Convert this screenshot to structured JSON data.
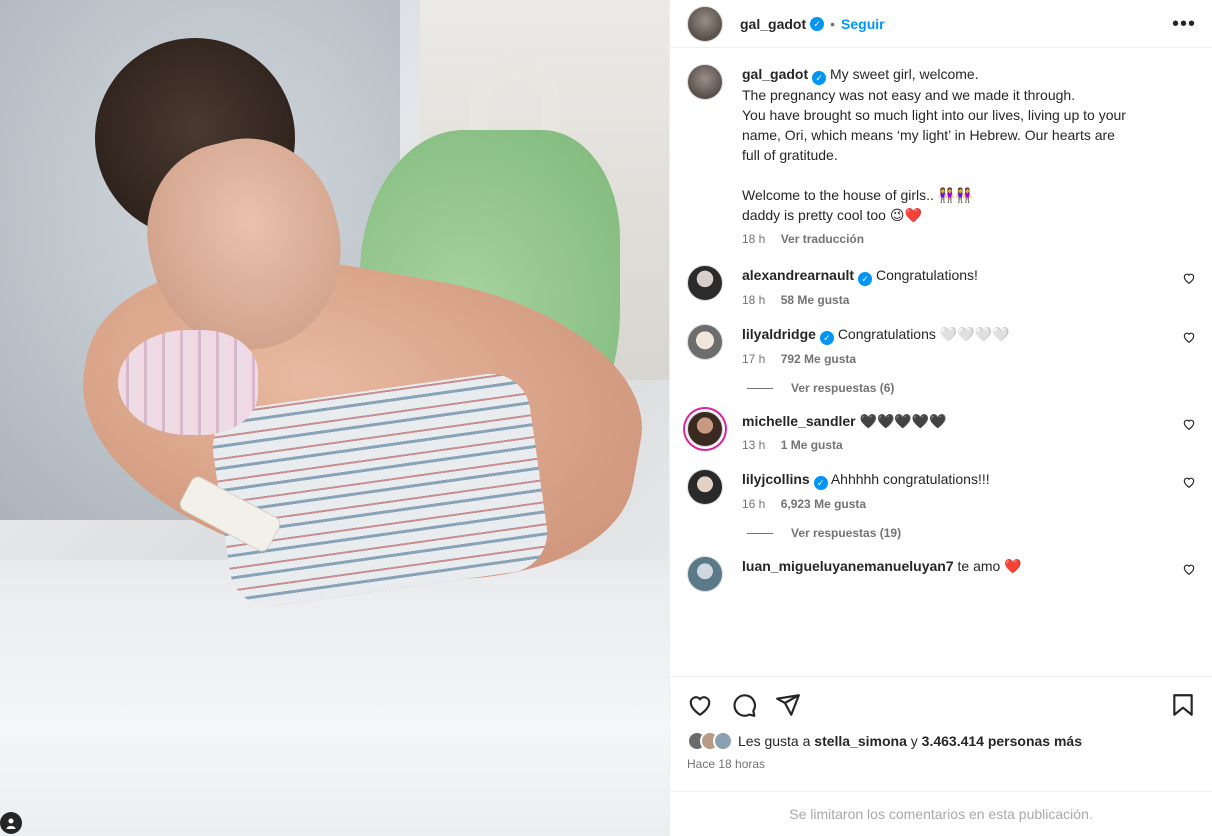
{
  "post": {
    "author": "gal_gadot",
    "follow_label": "Seguir",
    "more_label": "•••",
    "caption": {
      "lines": [
        "My sweet girl, welcome.",
        "The pregnancy was not easy and we made it through.",
        "You have brought so much light into our lives, living up to your",
        "name, Ori, which means ‘my light’ in Hebrew. Our hearts are",
        "full of gratitude.",
        "",
        "Welcome to the house of girls.. 👭👭",
        "daddy is pretty cool too 😉❤️"
      ],
      "time": "18 h",
      "translate_label": "Ver traducción"
    },
    "comments": [
      {
        "user": "alexandrearnault",
        "verified": true,
        "text": "Congratulations!",
        "time": "18 h",
        "likes": "58 Me gusta",
        "replies": ""
      },
      {
        "user": "lilyaldridge",
        "verified": true,
        "text": "Congratulations 🤍🤍🤍🤍",
        "time": "17 h",
        "likes": "792 Me gusta",
        "replies": "Ver respuestas (6)"
      },
      {
        "user": "michelle_sandler",
        "verified": false,
        "text": "🖤🖤🖤🖤🖤",
        "time": "13 h",
        "likes": "1 Me gusta",
        "replies": ""
      },
      {
        "user": "lilyjcollins",
        "verified": true,
        "text": "Ahhhhh congratulations!!!",
        "time": "16 h",
        "likes": "6,923 Me gusta",
        "replies": "Ver respuestas (19)"
      },
      {
        "user": "luan_migueluyanemanueluyan7",
        "verified": false,
        "text": "te amo ❤️",
        "time": "",
        "likes": "",
        "replies": ""
      }
    ],
    "likes_prefix": "Les gusta a",
    "likes_user": "stella_simona",
    "likes_conj": "y",
    "likes_count": "3.463.414 personas más",
    "posted_ago": "Hace 18 horas",
    "comments_limited": "Se limitaron los comentarios en esta publicación."
  },
  "icons": {
    "like": "heart-icon",
    "comment": "comment-icon",
    "share": "share-icon",
    "save": "bookmark-icon",
    "more": "more-options-icon",
    "verified": "verified-badge-icon",
    "tag": "user-tag-icon"
  },
  "colors": {
    "accent": "#0095f6",
    "text": "#262626",
    "secondary": "#737373",
    "border": "#efefef"
  }
}
